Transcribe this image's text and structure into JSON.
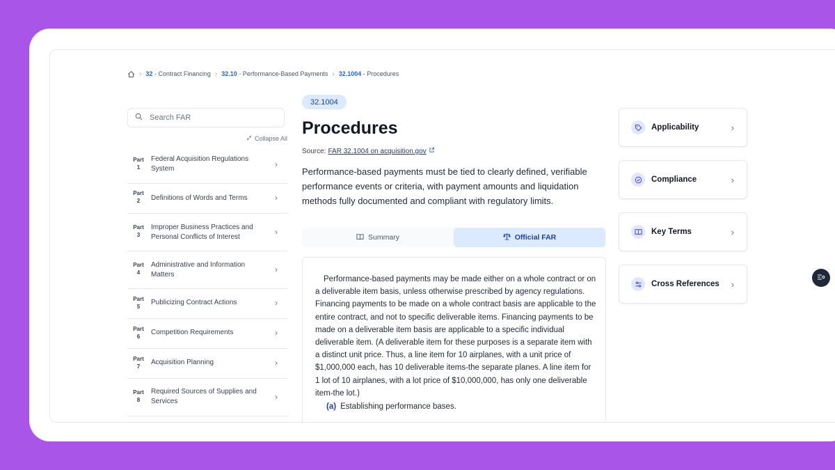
{
  "breadcrumb": [
    {
      "num": "32",
      "label": "- Contract Financing"
    },
    {
      "num": "32.10",
      "label": "- Performance-Based Payments"
    },
    {
      "num": "32.1004",
      "label": "- Procedures"
    }
  ],
  "sidebar": {
    "search_placeholder": "Search FAR",
    "collapse_label": "Collapse All",
    "parts": [
      {
        "part": "Part",
        "num": "1",
        "title": "Federal Acquisition Regulations System"
      },
      {
        "part": "Part",
        "num": "2",
        "title": "Definitions of Words and Terms"
      },
      {
        "part": "Part",
        "num": "3",
        "title": "Improper Business Practices and Personal Conflicts of Interest"
      },
      {
        "part": "Part",
        "num": "4",
        "title": "Administrative and Information Matters"
      },
      {
        "part": "Part",
        "num": "5",
        "title": "Publicizing Contract Actions"
      },
      {
        "part": "Part",
        "num": "6",
        "title": "Competition Requirements"
      },
      {
        "part": "Part",
        "num": "7",
        "title": "Acquisition Planning"
      },
      {
        "part": "Part",
        "num": "8",
        "title": "Required Sources of Supplies and Services"
      }
    ]
  },
  "main": {
    "badge": "32.1004",
    "title": "Procedures",
    "source_prefix": "Source:",
    "source_link": "FAR 32.1004 on acquisition.gov",
    "intro": "Performance-based payments must be tied to clearly defined, verifiable performance events or criteria, with payment amounts and liquidation methods fully documented and compliant with regulatory limits.",
    "tabs": [
      {
        "label": "Summary",
        "active": false
      },
      {
        "label": "Official FAR",
        "active": true
      }
    ],
    "body": "Performance-based payments may be made either on a whole contract or on a deliverable item basis, unless otherwise prescribed by agency regulations. Financing payments to be made on a whole contract basis are applicable to the entire contract, and not to specific deliverable items. Financing payments to be made on a deliverable item basis are applicable to a specific individual deliverable item. (A deliverable item for these purposes is a separate item with a distinct unit price. Thus, a line item for 10 airplanes, with a unit price of $1,000,000 each, has 10 deliverable items-the separate planes. A line item for 1 lot of 10 airplanes, with a lot price of $10,000,000, has only one deliverable item-the lot.)",
    "sub_label": "(a)",
    "sub_text": "Establishing performance bases."
  },
  "panel": {
    "cards": [
      {
        "label": "Applicability",
        "icon": "tag-icon"
      },
      {
        "label": "Compliance",
        "icon": "check-circle-icon"
      },
      {
        "label": "Key Terms",
        "icon": "book-icon"
      },
      {
        "label": "Cross References",
        "icon": "sliders-icon"
      }
    ]
  },
  "colors": {
    "background": "#a855e8",
    "accent": "#2563eb",
    "badge_bg": "#dbeafe"
  }
}
